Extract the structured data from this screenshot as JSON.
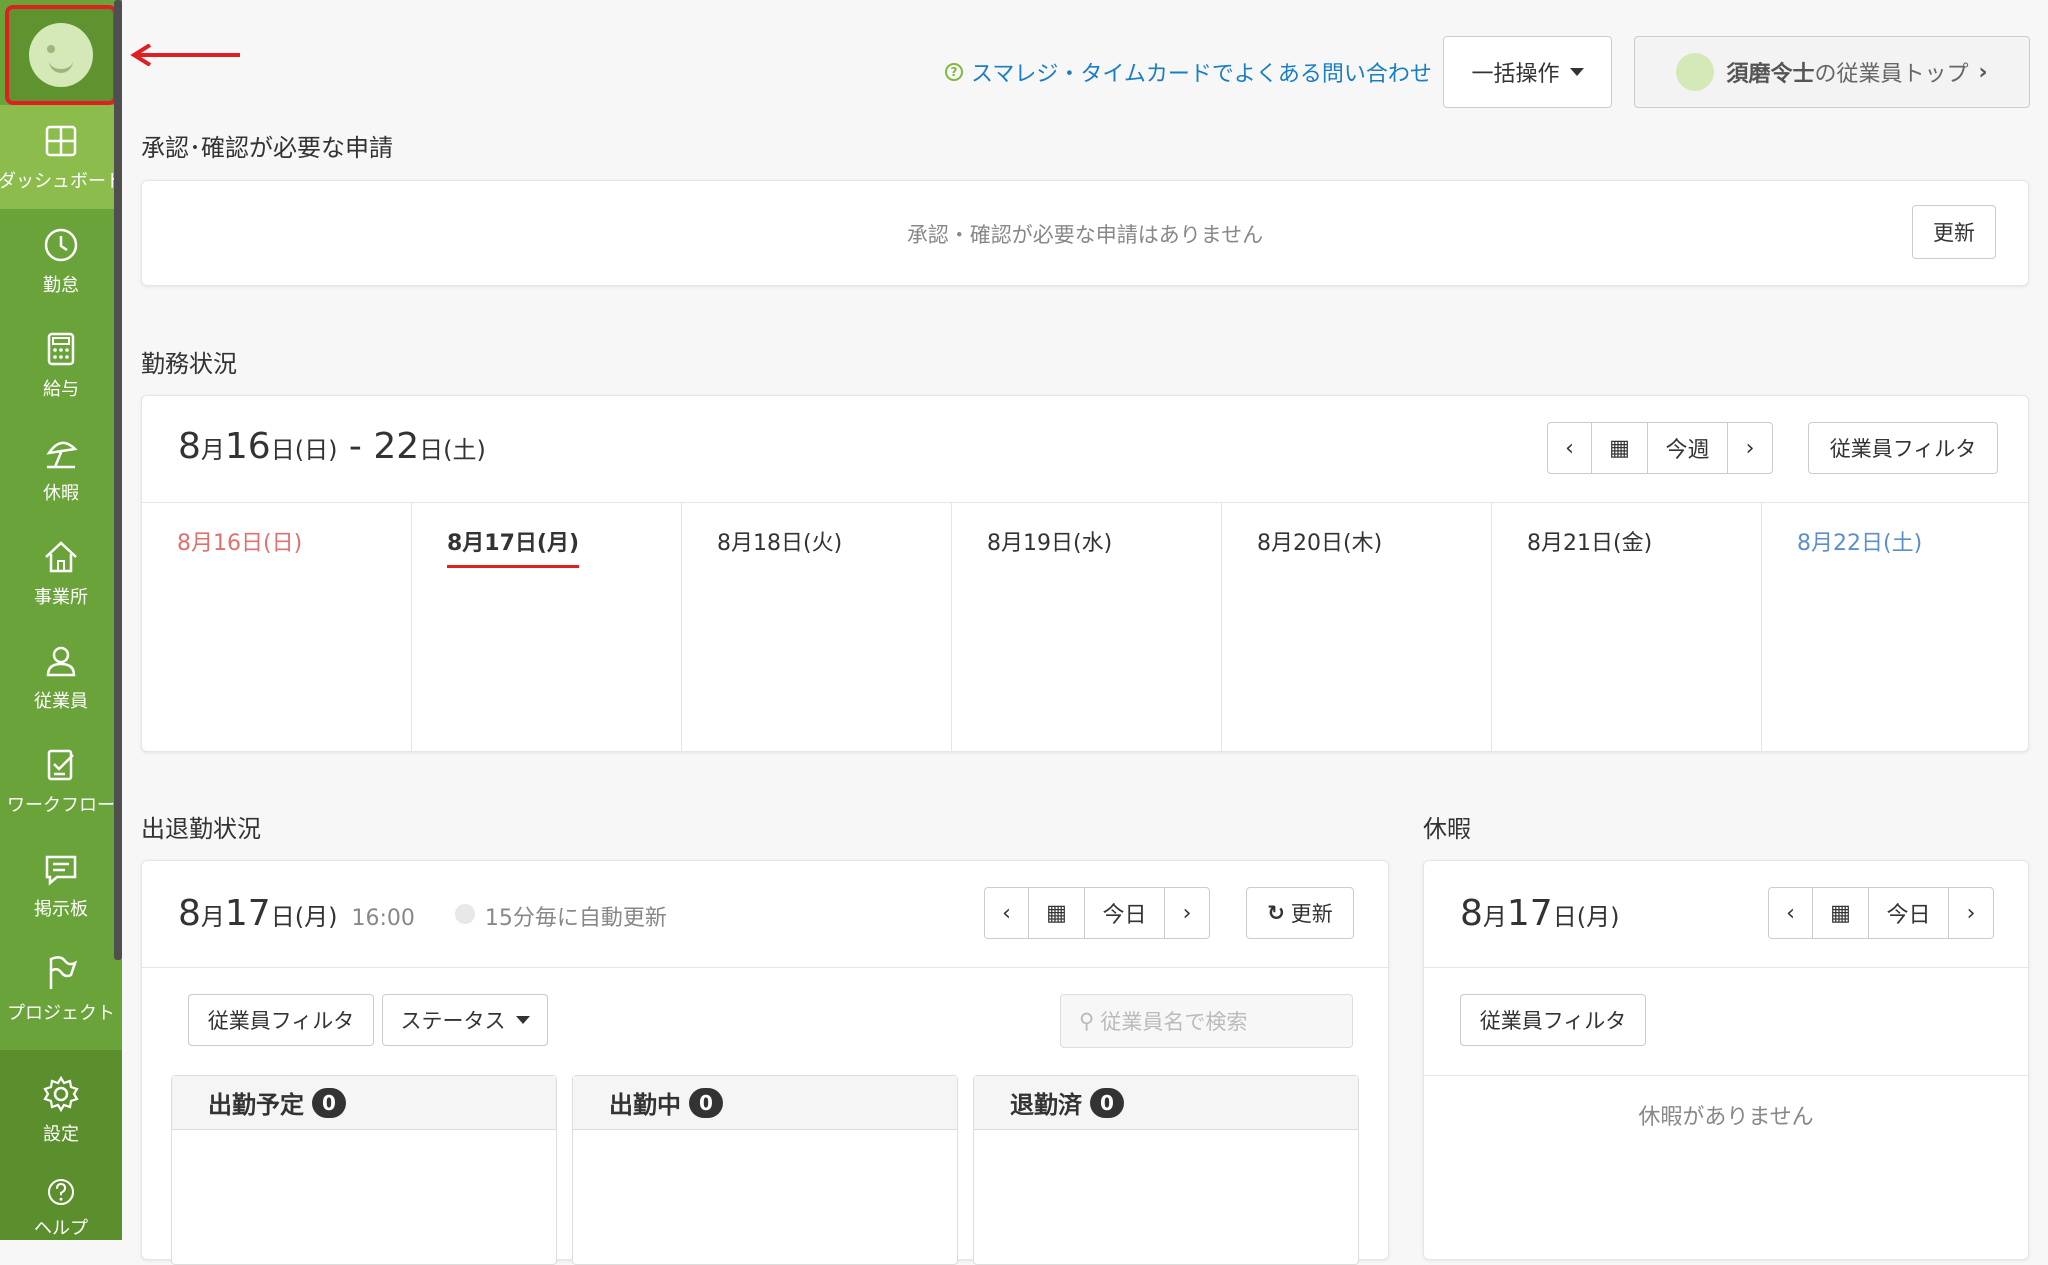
{
  "sidebar": {
    "items": [
      {
        "label": "ダッシュボード",
        "icon": "dashboard-icon"
      },
      {
        "label": "勤怠",
        "icon": "clock-icon"
      },
      {
        "label": "給与",
        "icon": "calculator-icon"
      },
      {
        "label": "休暇",
        "icon": "beach-umbrella-icon"
      },
      {
        "label": "事業所",
        "icon": "home-icon"
      },
      {
        "label": "従業員",
        "icon": "user-icon"
      },
      {
        "label": "ワークフロー",
        "icon": "checklist-icon"
      },
      {
        "label": "掲示板",
        "icon": "message-icon"
      },
      {
        "label": "プロジェクト",
        "icon": "flag-icon"
      },
      {
        "label": "設定",
        "icon": "gear-icon"
      },
      {
        "label": "ヘルプ",
        "icon": "help-icon"
      }
    ]
  },
  "header": {
    "faq_link": "スマレジ・タイムカードでよくある問い合わせ",
    "bulk_button": "一括操作",
    "user_name": "須磨令士",
    "user_suffix": "の従業員トップ"
  },
  "approval": {
    "title": "承認･確認が必要な申請",
    "empty_text": "承認・確認が必要な申請はありません",
    "refresh": "更新"
  },
  "work_status": {
    "title": "勤務状況",
    "range_month": "8",
    "range_day1": "16",
    "range_wd1": "(日)",
    "range_sep": " - ",
    "range_day2": "22",
    "range_wd2": "(土)",
    "nav_today": "今週",
    "filter": "従業員フィルタ",
    "days": [
      "8月16日(日)",
      "8月17日(月)",
      "8月18日(火)",
      "8月19日(水)",
      "8月20日(木)",
      "8月21日(金)",
      "8月22日(土)"
    ]
  },
  "attendance": {
    "title": "出退勤状況",
    "month": "8",
    "day": "17",
    "weekday": "(月)",
    "time": "16:00",
    "auto_refresh": "15分毎に自動更新",
    "nav_today": "今日",
    "refresh": "更新",
    "filter": "従業員フィルタ",
    "status": "ステータス",
    "search_placeholder": "従業員名で検索",
    "columns": [
      {
        "label": "出勤予定",
        "count": "0"
      },
      {
        "label": "出勤中",
        "count": "0"
      },
      {
        "label": "退勤済",
        "count": "0"
      }
    ]
  },
  "vacation": {
    "title": "休暇",
    "month": "8",
    "day": "17",
    "weekday": "(月)",
    "nav_today": "今日",
    "filter": "従業員フィルタ",
    "empty_text": "休暇がありません"
  },
  "colors": {
    "sidebar": "#6aa33a",
    "active": "#8cbd4c",
    "sunday": "#e07070",
    "saturday": "#5b8fc9",
    "link": "#1a7ec2",
    "highlight": "#e02020"
  }
}
